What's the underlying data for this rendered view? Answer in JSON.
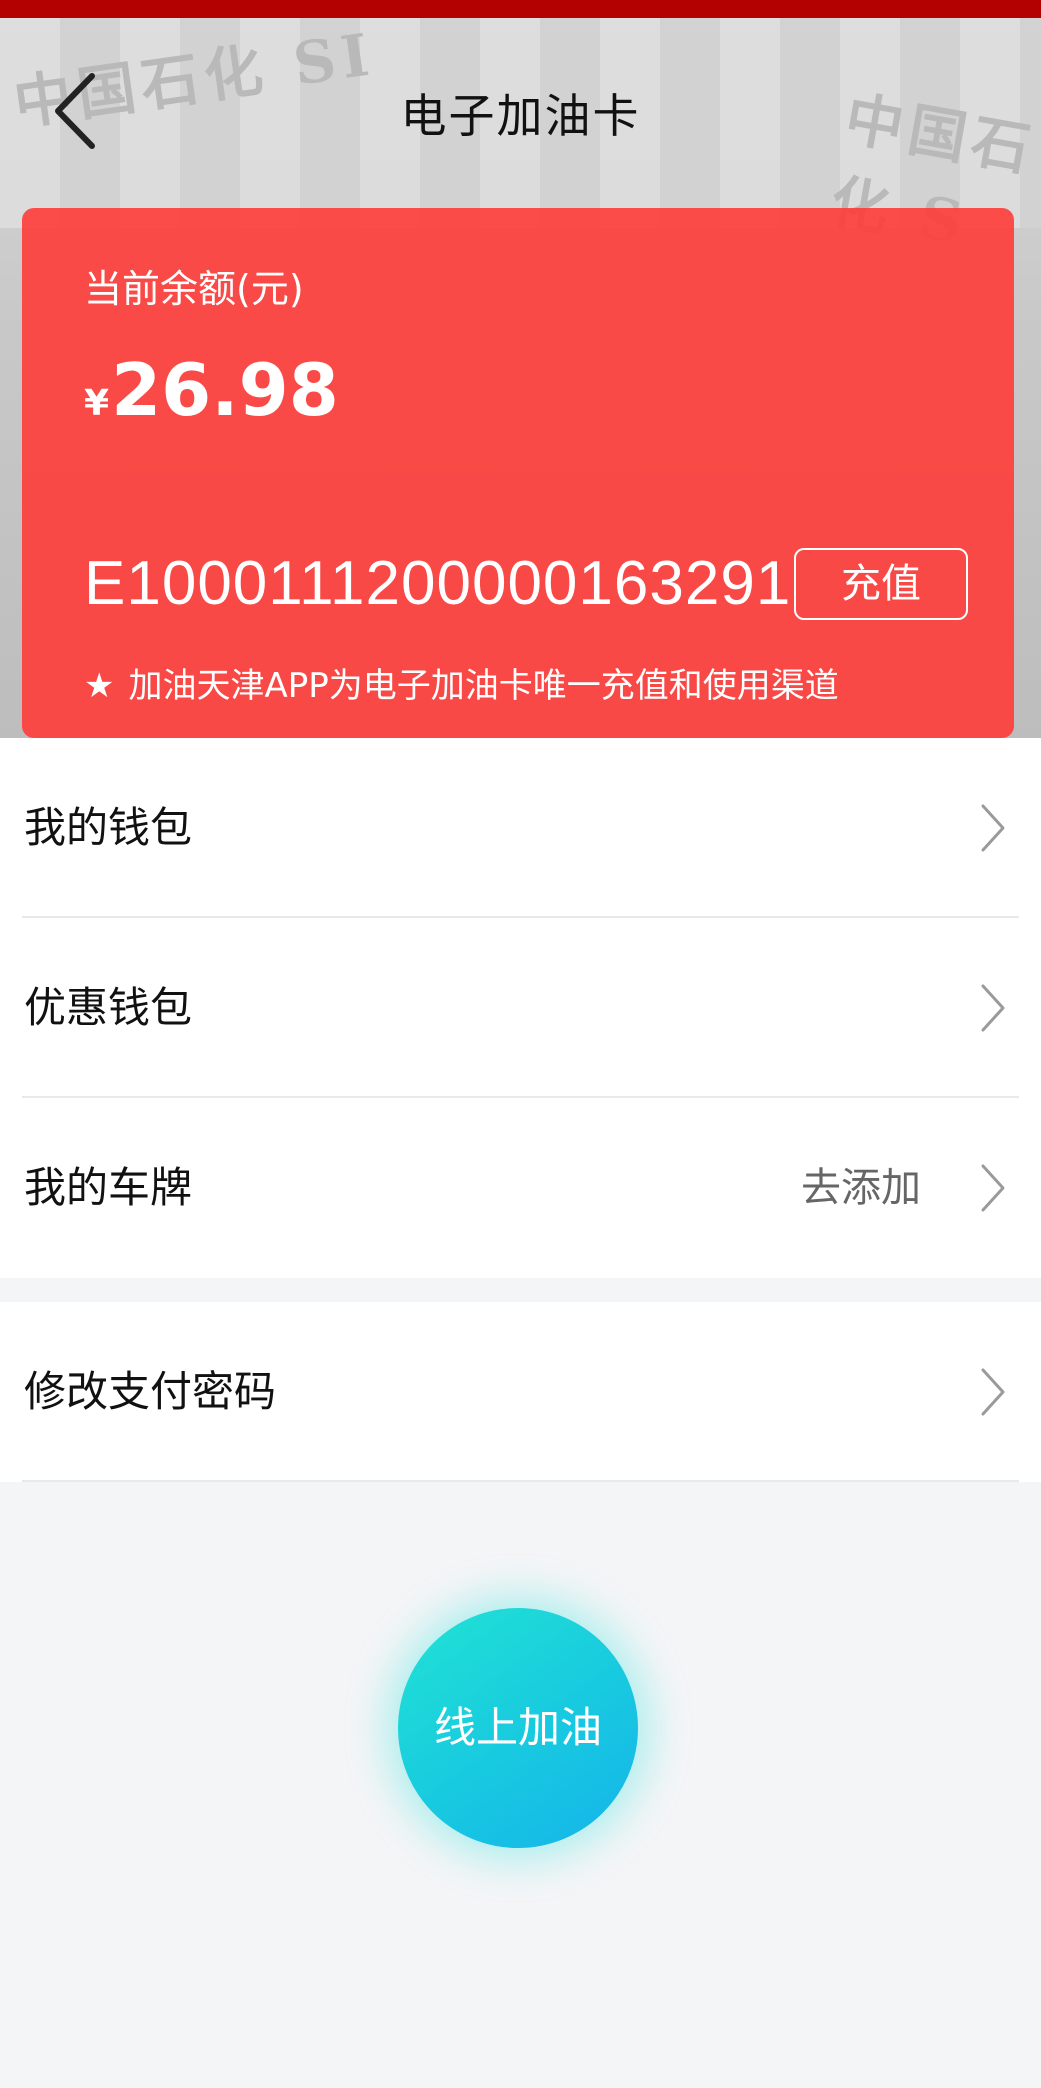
{
  "nav": {
    "title": "电子加油卡"
  },
  "hero": {
    "bg_text_left": "中国石化 SI",
    "bg_text_right": "中国石化 S"
  },
  "card": {
    "balance_label": "当前余额(元)",
    "currency": "¥",
    "balance": "26.98",
    "card_number": "E1000111200000163291",
    "recharge_label": "充值",
    "notice_star": "★",
    "notice": "加油天津APP为电子加油卡唯一充值和使用渠道"
  },
  "menu": {
    "wallet": "我的钱包",
    "coupon_wallet": "优惠钱包",
    "plate": "我的车牌",
    "plate_action": "去添加",
    "change_password": "修改支付密码"
  },
  "actions": {
    "online_fuel": "线上加油"
  },
  "colors": {
    "status_bar": "#b30000",
    "card": "#ff3c38",
    "button_gradient_start": "#21e3d3",
    "button_gradient_end": "#14b4ea"
  }
}
